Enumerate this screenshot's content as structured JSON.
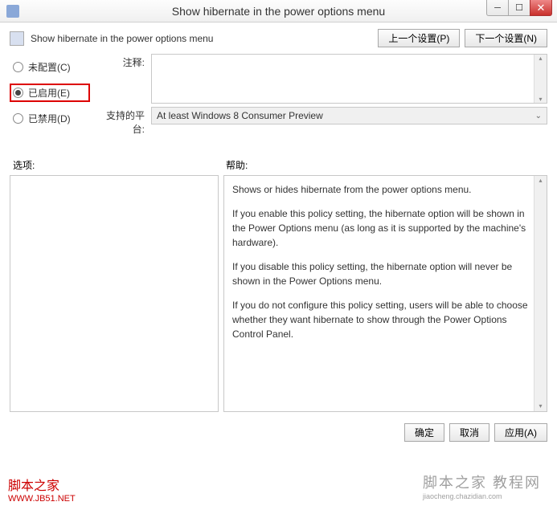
{
  "window": {
    "title": "Show hibernate in the power options menu"
  },
  "header": {
    "title": "Show hibernate in the power options menu",
    "prev_btn": "上一个设置(P)",
    "next_btn": "下一个设置(N)"
  },
  "radios": {
    "not_configured": "未配置(C)",
    "enabled": "已启用(E)",
    "disabled": "已禁用(D)",
    "selected": "enabled"
  },
  "fields": {
    "comment_label": "注释:",
    "comment_value": "",
    "platform_label": "支持的平台:",
    "platform_value": "At least Windows 8 Consumer Preview"
  },
  "sections": {
    "options_label": "选项:",
    "help_label": "帮助:"
  },
  "help": {
    "p1": "Shows or hides hibernate from the power options menu.",
    "p2": "If you enable this policy setting, the hibernate option will be shown in the Power Options menu (as long as it is supported by the machine's hardware).",
    "p3": "If you disable this policy setting, the hibernate option will never be shown in the Power Options menu.",
    "p4": "If you do not configure this policy setting, users will be able to choose whether they want hibernate to show through the Power Options Control Panel."
  },
  "footer": {
    "ok": "确定",
    "cancel": "取消",
    "apply": "应用(A)"
  },
  "watermarks": {
    "left_line1": "脚本之家",
    "left_line2": "WWW.JB51.NET",
    "right_line1": "脚本之家 教程网",
    "right_line2": "jiaocheng.chazidian.com"
  }
}
